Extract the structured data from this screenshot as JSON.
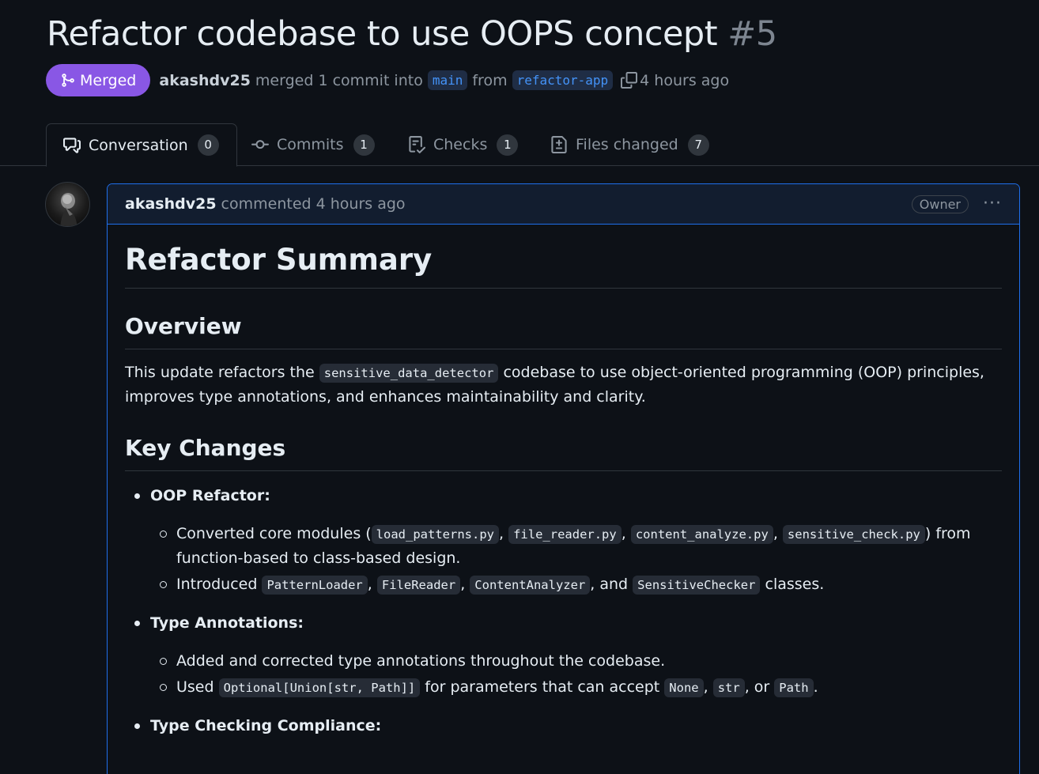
{
  "pr": {
    "title": "Refactor codebase to use OOPS concept",
    "number": "#5",
    "status": "Merged",
    "author": "akashdv25",
    "merge_text": "merged 1 commit into",
    "base_branch": "main",
    "from_text": "from",
    "head_branch": "refactor-app",
    "time": "4 hours ago"
  },
  "tabs": [
    {
      "label": "Conversation",
      "count": "0",
      "icon": "comment-discussion-icon"
    },
    {
      "label": "Commits",
      "count": "1",
      "icon": "git-commit-icon"
    },
    {
      "label": "Checks",
      "count": "1",
      "icon": "checklist-icon"
    },
    {
      "label": "Files changed",
      "count": "7",
      "icon": "file-diff-icon"
    }
  ],
  "comment": {
    "author": "akashdv25",
    "action": "commented 4 hours ago",
    "badge": "Owner",
    "menu": "···",
    "h1": "Refactor Summary",
    "overview_heading": "Overview",
    "overview": {
      "before": "This update refactors the ",
      "code": "sensitive_data_detector",
      "after": " codebase to use object-oriented programming (OOP) principles, improves type annotations, and enhances maintainability and clarity."
    },
    "key_changes_heading": "Key Changes",
    "sections": [
      {
        "label": "OOP Refactor:"
      },
      {
        "label": "Type Annotations:"
      },
      {
        "label": "Type Checking Compliance:"
      }
    ],
    "oop": {
      "item1": {
        "prefix": "Converted core modules (",
        "codes": [
          "load_patterns.py",
          "file_reader.py",
          "content_analyze.py",
          "sensitive_check.py"
        ],
        "sep": ",",
        "suffix": ") from function-based to class-based design."
      },
      "item2": {
        "prefix": "Introduced ",
        "codes": [
          "PatternLoader",
          "FileReader",
          "ContentAnalyzer",
          "SensitiveChecker"
        ],
        "sep": ",",
        "and": ", and",
        "suffix": " classes."
      }
    },
    "types": {
      "item1": "Added and corrected type annotations throughout the codebase.",
      "item2": {
        "prefix": "Used ",
        "code": "Optional[Union[str, Path]]",
        "middle": " for parameters that can accept ",
        "codes": [
          "None",
          "str",
          "Path"
        ],
        "sep": ",",
        "or": ", or",
        "end": "."
      }
    }
  }
}
